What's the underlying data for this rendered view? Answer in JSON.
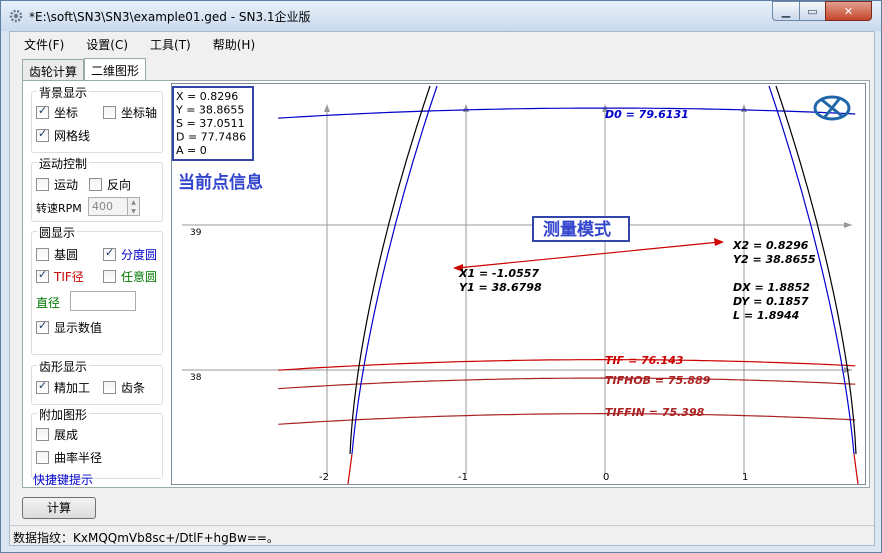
{
  "window": {
    "title": "*E:\\soft\\SN3\\SN3\\example01.ged - SN3.1企业版",
    "min_symbol": "▁",
    "max_symbol": "▭",
    "close_symbol": "✕"
  },
  "menu": [
    "文件(F)",
    "设置(C)",
    "工具(T)",
    "帮助(H)"
  ],
  "tabs": [
    "齿轮计算",
    "二维图形"
  ],
  "active_tab": 1,
  "panel": {
    "background": {
      "title": "背景显示",
      "coords": {
        "label": "坐标",
        "checked": true
      },
      "axes": {
        "label": "坐标轴",
        "checked": false
      },
      "grid": {
        "label": "网格线",
        "checked": true
      }
    },
    "motion": {
      "title": "运动控制",
      "move": {
        "label": "运动",
        "checked": false
      },
      "reverse": {
        "label": "反向",
        "checked": false
      },
      "rpm_label": "转速RPM",
      "rpm_value": "400"
    },
    "circles": {
      "title": "圆显示",
      "base": {
        "label": "基圆",
        "checked": false
      },
      "pitch": {
        "label": "分度圆",
        "checked": true,
        "color": "#0000cc"
      },
      "tif": {
        "label": "TIF径",
        "checked": true,
        "color": "#cc0000"
      },
      "any": {
        "label": "任意圆",
        "checked": false,
        "color": "#007700"
      },
      "diameter_label": "直径",
      "diameter_color": "#007700",
      "show_values": {
        "label": "显示数值",
        "checked": true
      }
    },
    "tooth": {
      "title": "齿形显示",
      "finish": {
        "label": "精加工",
        "checked": true
      },
      "rack": {
        "label": "齿条",
        "checked": false
      }
    },
    "extra": {
      "title": "附加图形",
      "generate": {
        "label": "展成",
        "checked": false
      },
      "curvature": {
        "label": "曲率半径",
        "checked": false
      }
    },
    "shortcut": "快捷键提示"
  },
  "chart_data": {
    "type": "line",
    "xlim": [
      -2.3,
      1.8
    ],
    "ylim": [
      37.2,
      39.5
    ],
    "x_ticks": [
      "-2",
      "-1",
      "0",
      "1"
    ],
    "y_ticks": [
      "39",
      "38"
    ],
    "grid": true,
    "point_info": [
      "X = 0.8296",
      "Y = 38.8655",
      "S = 37.0511",
      "D = 77.7486",
      "A = 0"
    ],
    "point_info_caption": "当前点信息",
    "measure_caption": "测量模式",
    "circles": [
      {
        "name": "D0",
        "label": "D0 = 79.6131",
        "radius": 39.80655,
        "color": "#0000cc"
      },
      {
        "name": "TIF",
        "label": "TIF = 76.143",
        "radius": 38.0715,
        "color": "#cc0000"
      },
      {
        "name": "TIFHOB",
        "label": "TIFHOB = 75.889",
        "radius": 37.9445,
        "color": "#aa2222"
      },
      {
        "name": "TIFFIN",
        "label": "TIFFIN = 75.398",
        "radius": 37.699,
        "color": "#aa2222"
      }
    ],
    "measure": {
      "p1": [
        "X1 = -1.0557",
        "Y1 = 38.6798"
      ],
      "p2": [
        "X2 = 0.8296",
        "Y2 = 38.8655"
      ],
      "deltas": [
        "DX = 1.8852",
        "DY = 0.1857",
        "L = 1.8944"
      ]
    }
  },
  "calc_button": "计算",
  "status": "数据指纹：KxMQQmVb8sc+/DtlF+hgBw==。"
}
